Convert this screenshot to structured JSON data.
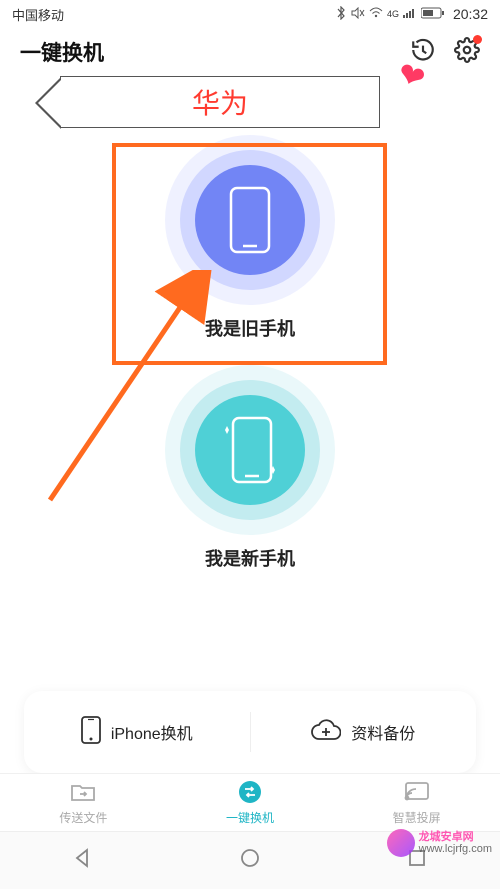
{
  "statusbar": {
    "carrier": "中国移动",
    "network": "4G",
    "time": "20:32"
  },
  "appbar": {
    "title": "一键换机"
  },
  "callout": {
    "label": "华为"
  },
  "options": {
    "old_phone": "我是旧手机",
    "new_phone": "我是新手机"
  },
  "actions": {
    "iphone": "iPhone换机",
    "backup": "资料备份"
  },
  "tabs": {
    "send": "传送文件",
    "clone": "一键换机",
    "cast": "智慧投屏"
  },
  "watermark": {
    "name": "龙城安卓网",
    "url": "www.lcjrfg.com"
  }
}
